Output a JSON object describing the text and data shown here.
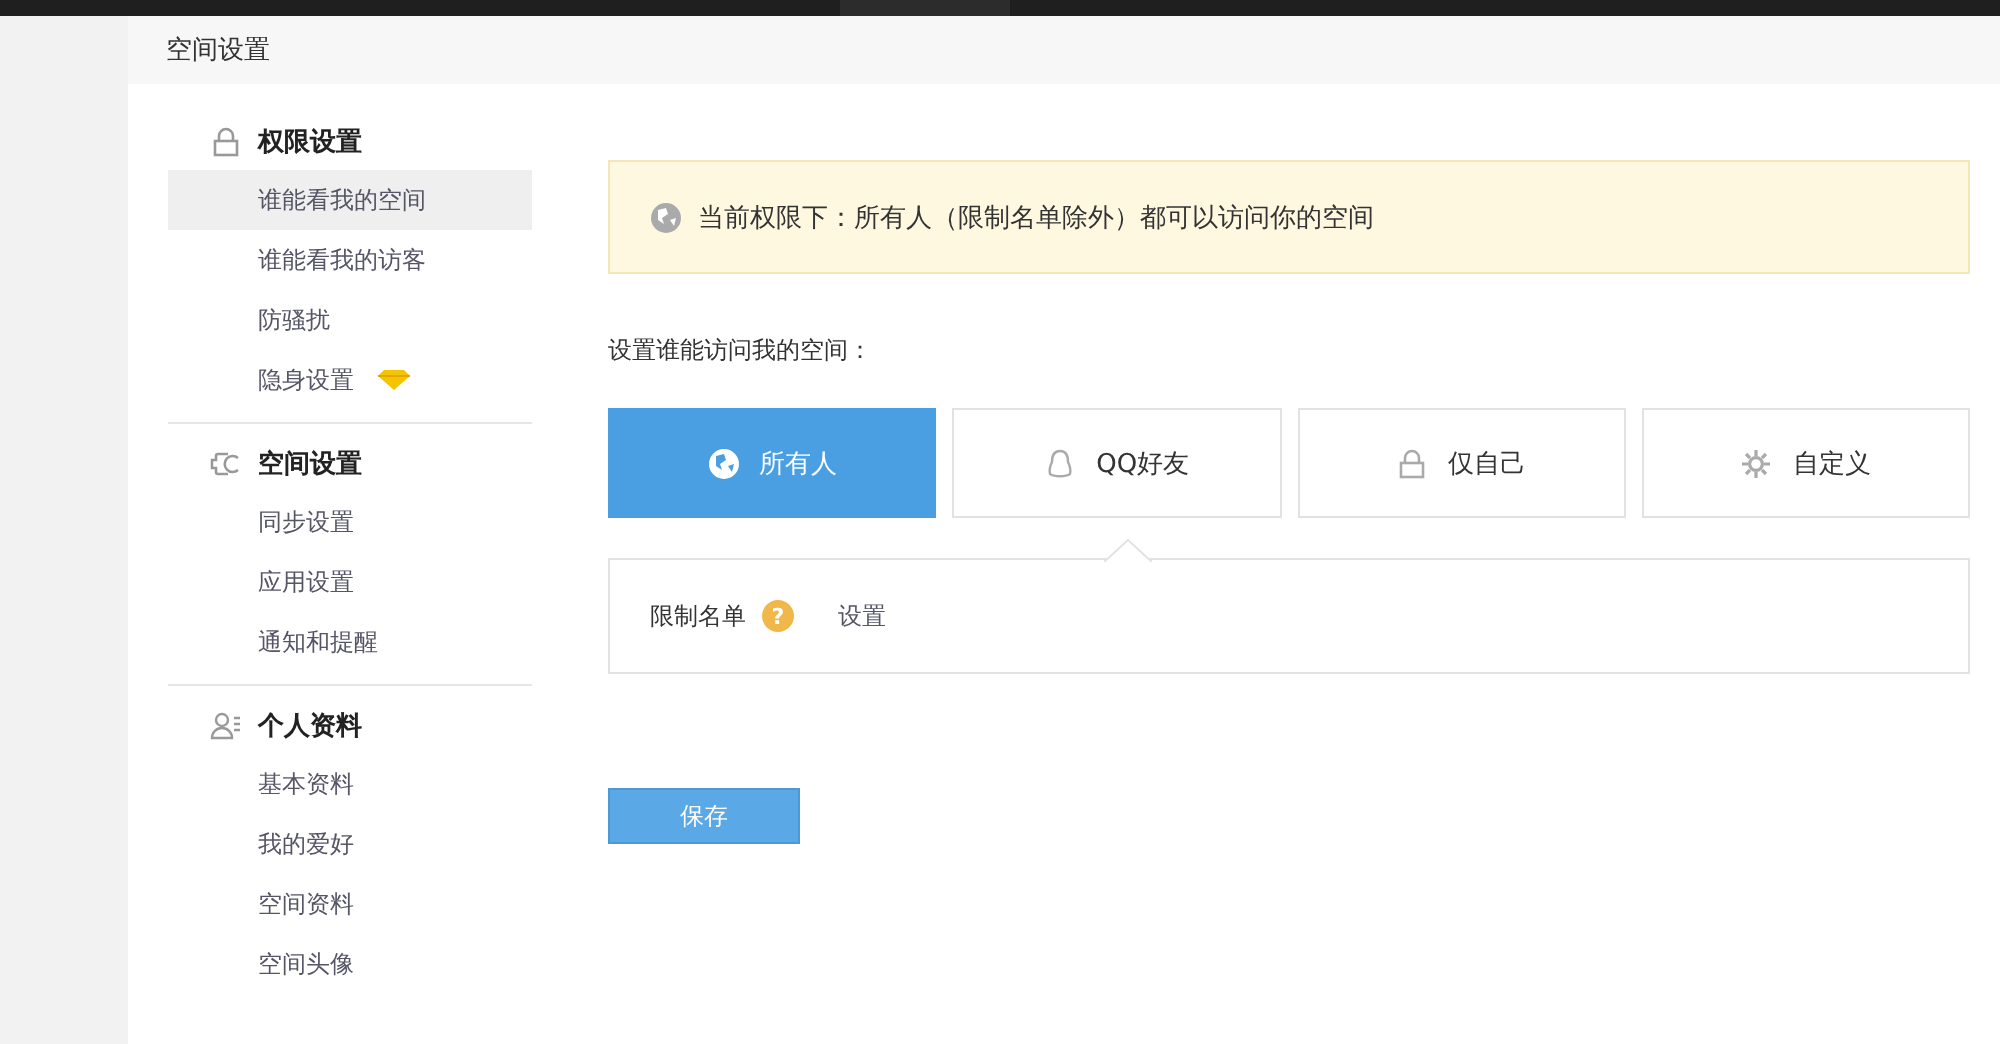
{
  "header": {
    "title": "空间设置"
  },
  "sidebar": [
    {
      "kind": "lock",
      "title": "权限设置",
      "items": [
        {
          "label": "谁能看我的空间",
          "selected": true,
          "vip": false
        },
        {
          "label": "谁能看我的访客",
          "selected": false,
          "vip": false
        },
        {
          "label": "防骚扰",
          "selected": false,
          "vip": false
        },
        {
          "label": "隐身设置",
          "selected": false,
          "vip": true
        }
      ]
    },
    {
      "kind": "plug",
      "title": "空间设置",
      "items": [
        {
          "label": "同步设置",
          "selected": false,
          "vip": false
        },
        {
          "label": "应用设置",
          "selected": false,
          "vip": false
        },
        {
          "label": "通知和提醒",
          "selected": false,
          "vip": false
        }
      ]
    },
    {
      "kind": "person",
      "title": "个人资料",
      "items": [
        {
          "label": "基本资料",
          "selected": false,
          "vip": false
        },
        {
          "label": "我的爱好",
          "selected": false,
          "vip": false
        },
        {
          "label": "空间资料",
          "selected": false,
          "vip": false
        },
        {
          "label": "空间头像",
          "selected": false,
          "vip": false
        }
      ]
    }
  ],
  "notice": "当前权限下：所有人（限制名单除外）都可以访问你的空间",
  "prompt": "设置谁能访问我的空间：",
  "options": [
    {
      "kind": "globe",
      "label": "所有人",
      "selected": true
    },
    {
      "kind": "qq",
      "label": "QQ好友",
      "selected": false
    },
    {
      "kind": "lock",
      "label": "仅自己",
      "selected": false
    },
    {
      "kind": "gear",
      "label": "自定义",
      "selected": false
    }
  ],
  "restrict": {
    "label": "限制名单",
    "help": "?",
    "link": "设置"
  },
  "save_button": "保存"
}
